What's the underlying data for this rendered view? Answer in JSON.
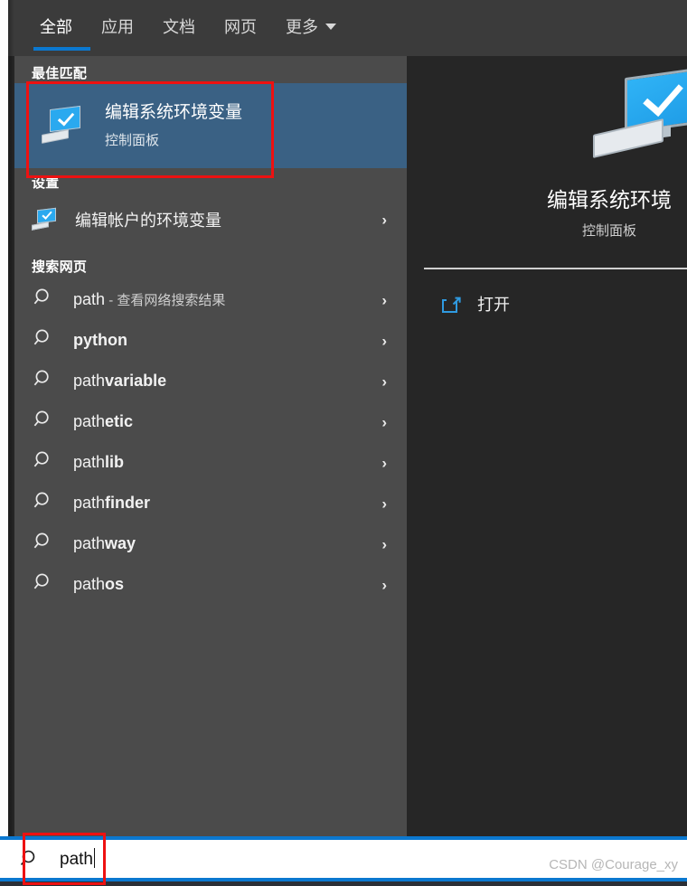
{
  "tabs": [
    {
      "label": "全部",
      "active": true
    },
    {
      "label": "应用",
      "active": false
    },
    {
      "label": "文档",
      "active": false
    },
    {
      "label": "网页",
      "active": false
    },
    {
      "label": "更多",
      "active": false,
      "caret": true
    }
  ],
  "groups": {
    "best_match_header": "最佳匹配",
    "settings_header": "设置",
    "web_header": "搜索网页"
  },
  "best_match": {
    "title": "编辑系统环境变量",
    "subtitle": "控制面板",
    "icon": "monitor-check-icon"
  },
  "settings_items": [
    {
      "label": "编辑帐户的环境变量",
      "icon": "monitor-check-icon",
      "chevron": "›"
    }
  ],
  "web_items": [
    {
      "prefix": "path",
      "bold": "",
      "suffix": " - 查看网络搜索结果",
      "icon": "search-icon",
      "chevron": "›"
    },
    {
      "prefix": "",
      "bold": "python",
      "suffix": "",
      "icon": "search-icon",
      "chevron": "›"
    },
    {
      "prefix": "path",
      "bold": "variable",
      "suffix": "",
      "icon": "search-icon",
      "chevron": "›"
    },
    {
      "prefix": "path",
      "bold": "etic",
      "suffix": "",
      "icon": "search-icon",
      "chevron": "›"
    },
    {
      "prefix": "path",
      "bold": "lib",
      "suffix": "",
      "icon": "search-icon",
      "chevron": "›"
    },
    {
      "prefix": "path",
      "bold": "finder",
      "suffix": "",
      "icon": "search-icon",
      "chevron": "›"
    },
    {
      "prefix": "path",
      "bold": "way",
      "suffix": "",
      "icon": "search-icon",
      "chevron": "›"
    },
    {
      "prefix": "path",
      "bold": "os",
      "suffix": "",
      "icon": "search-icon",
      "chevron": "›"
    }
  ],
  "preview": {
    "title": "编辑系统环境",
    "subtitle": "控制面板",
    "action_label": "打开",
    "action_icon": "open-external-icon",
    "app_icon": "monitor-check-icon"
  },
  "search": {
    "value": "path",
    "icon": "search-icon",
    "left_glyph": "</"
  },
  "watermark": "CSDN @Courage_xy",
  "colors": {
    "accent": "#0b78d0",
    "selected_row": "#3a6184",
    "list_bg": "#4b4b4b",
    "preview_bg": "#262626",
    "tabbar_bg": "#3b3b3b",
    "annotation": "#ee1111",
    "icon_blue": "#2aa9ef"
  }
}
